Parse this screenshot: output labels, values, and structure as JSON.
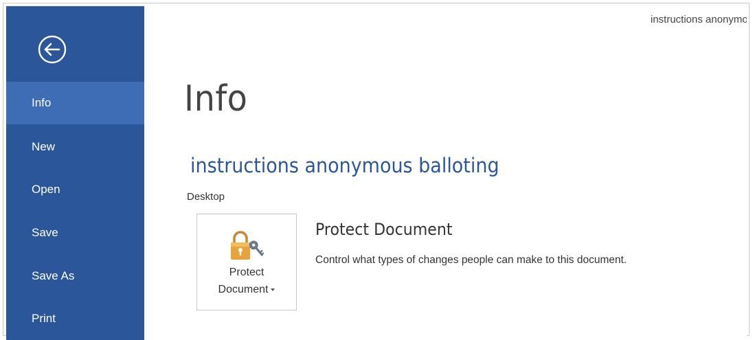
{
  "window": {
    "doc_title": "instructions anonymous balloting"
  },
  "sidebar": {
    "back_label": "Back",
    "items": [
      {
        "label": "Info",
        "active": true
      },
      {
        "label": "New",
        "active": false
      },
      {
        "label": "Open",
        "active": false
      },
      {
        "label": "Save",
        "active": false
      },
      {
        "label": "Save As",
        "active": false
      },
      {
        "label": "Print",
        "active": false
      }
    ]
  },
  "main": {
    "title": "Info",
    "document_name": "instructions anonymous balloting",
    "document_location": "Desktop",
    "protect": {
      "button_line1": "Protect",
      "button_line2": "Document",
      "heading": "Protect Document",
      "description": "Control what types of changes people can make to this document."
    }
  },
  "colors": {
    "sidebar_bg": "#2b579a",
    "sidebar_active": "#3e6db5",
    "accent_text": "#2b579a",
    "lock_gold": "#e8a33c"
  }
}
